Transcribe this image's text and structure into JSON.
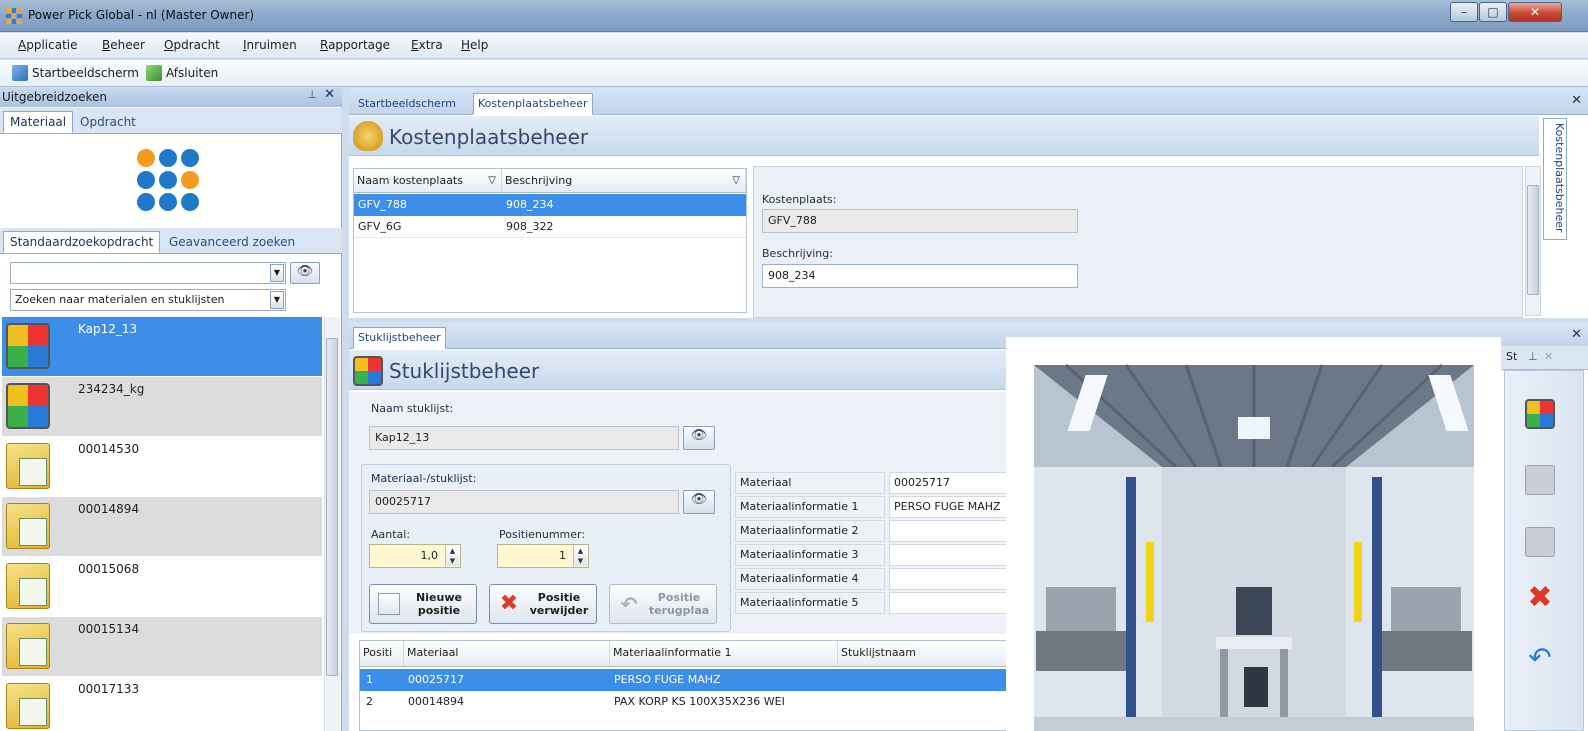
{
  "window": {
    "title": "Power Pick Global - nl (Master Owner)"
  },
  "menu": {
    "items": [
      "Applicatie",
      "Beheer",
      "Opdracht",
      "Inruimen",
      "Rapportage",
      "Extra",
      "Help"
    ]
  },
  "toolbar": {
    "home_label": "Startbeeldscherm",
    "exit_label": "Afsluiten"
  },
  "search_panel": {
    "title": "Uitgebreidzoeken",
    "tabs": [
      "Materiaal",
      "Opdracht"
    ],
    "subtabs": [
      "Standaardzoekopdracht",
      "Geavanceerd zoeken"
    ],
    "search_value": "",
    "search_mode": "Zoeken naar materialen en stuklijsten",
    "results": [
      {
        "label": "Kap12_13",
        "icon": "bom-cube-icon",
        "selected": true
      },
      {
        "label": "234234_kg",
        "icon": "bom-cube-icon",
        "selected": false
      },
      {
        "label": "00014530",
        "icon": "material-folder-icon",
        "selected": false
      },
      {
        "label": "00014894",
        "icon": "material-folder-icon",
        "selected": false
      },
      {
        "label": "00015068",
        "icon": "material-folder-icon",
        "selected": false
      },
      {
        "label": "00015134",
        "icon": "material-folder-icon",
        "selected": false
      },
      {
        "label": "00017133",
        "icon": "material-folder-icon",
        "selected": false
      }
    ]
  },
  "doc_tabs": [
    "Startbeeldscherm",
    "Kostenplaatsbeheer"
  ],
  "cost_center": {
    "title": "Kostenplaatsbeheer",
    "side_tab": "Kostenplaatsbeheer",
    "columns": [
      "Naam kostenplaats",
      "Beschrijving"
    ],
    "rows": [
      {
        "name": "GFV_788",
        "desc": "908_234",
        "selected": true
      },
      {
        "name": "GFV_6G",
        "desc": "908_322",
        "selected": false
      }
    ],
    "detail": {
      "name_label": "Kostenplaats:",
      "name_value": "GFV_788",
      "desc_label": "Beschrijving:",
      "desc_value": "908_234"
    }
  },
  "bom": {
    "tab": "Stuklijstbeheer",
    "title": "Stuklijstbeheer",
    "name_label": "Naam stuklijst:",
    "name_value": "Kap12_13",
    "material_label": "Materiaal-/stuklijst:",
    "material_value": "00025717",
    "qty_label": "Aantal:",
    "qty_value": "1,0",
    "pos_label": "Positienummer:",
    "pos_value": "1",
    "buttons": {
      "new": [
        "Nieuwe",
        "positie"
      ],
      "delete": [
        "Positie",
        "verwijder"
      ],
      "restore": [
        "Positie",
        "terugplaa"
      ]
    },
    "info_labels": [
      "Materiaal",
      "Materiaalinformatie 1",
      "Materiaalinformatie 2",
      "Materiaalinformatie 3",
      "Materiaalinformatie 4",
      "Materiaalinformatie 5"
    ],
    "info_values": [
      "00025717",
      "PERSO FUGE MAHZ",
      "",
      "",
      "",
      ""
    ],
    "table_columns": [
      "Positi",
      "Materiaal",
      "Materiaalinformatie 1",
      "Stuklijstnaam"
    ],
    "table_rows": [
      {
        "pos": "1",
        "material": "00025717",
        "info1": "PERSO FUGE MAHZ",
        "name": "",
        "selected": true
      },
      {
        "pos": "2",
        "material": "00014894",
        "info1": "PAX KORP KS 100X35X236 WEI",
        "name": "",
        "selected": false
      }
    ]
  },
  "right_dock": {
    "label": "St"
  },
  "colors": {
    "selection": "#3d8ee8",
    "accent": "#1f78c8",
    "logo_orange": "#f49a1c"
  }
}
